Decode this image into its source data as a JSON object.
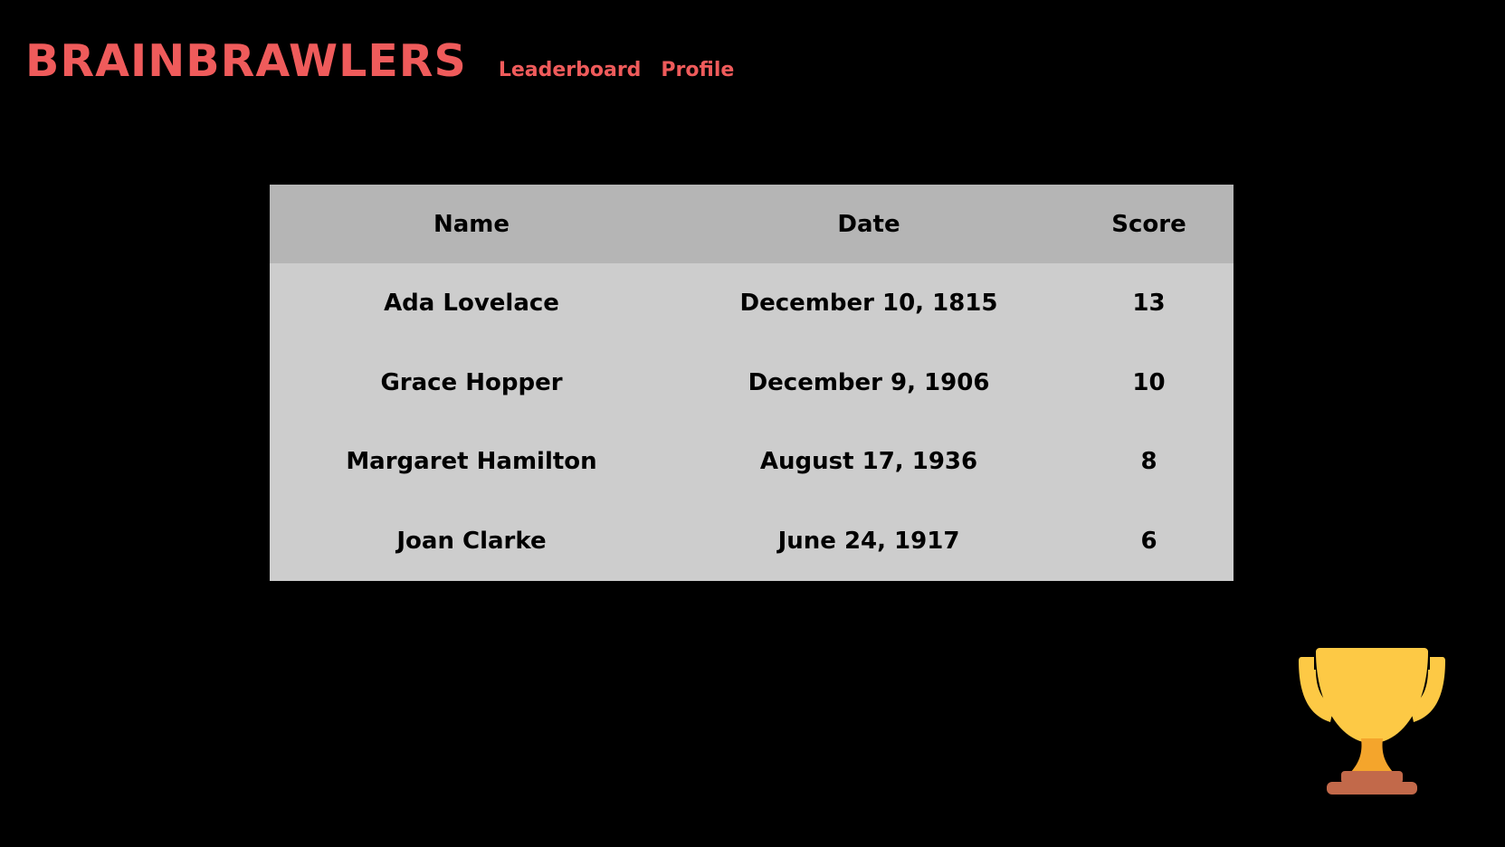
{
  "app": {
    "title": "BRAINBRAWLERS"
  },
  "nav": {
    "items": [
      {
        "label": "Leaderboard"
      },
      {
        "label": "Profile"
      }
    ]
  },
  "leaderboard": {
    "headers": [
      "Name",
      "Date",
      "Score"
    ],
    "rows": [
      {
        "name": "Ada Lovelace",
        "date": "December 10, 1815",
        "score": "13"
      },
      {
        "name": "Grace Hopper",
        "date": "December 9, 1906",
        "score": "10"
      },
      {
        "name": "Margaret Hamilton",
        "date": "August 17, 1936",
        "score": "8"
      },
      {
        "name": "Joan Clarke",
        "date": "June 24, 1917",
        "score": "6"
      }
    ]
  },
  "icons": {
    "trophy": "trophy-icon"
  },
  "colors": {
    "background": "#000000",
    "accent": "#ef5b5b",
    "table_header": "#b5b5b5",
    "table_body": "#cdcdcd",
    "trophy_gold": "#fdc945",
    "trophy_stem": "#f4a52c",
    "trophy_base": "#c2694a"
  }
}
